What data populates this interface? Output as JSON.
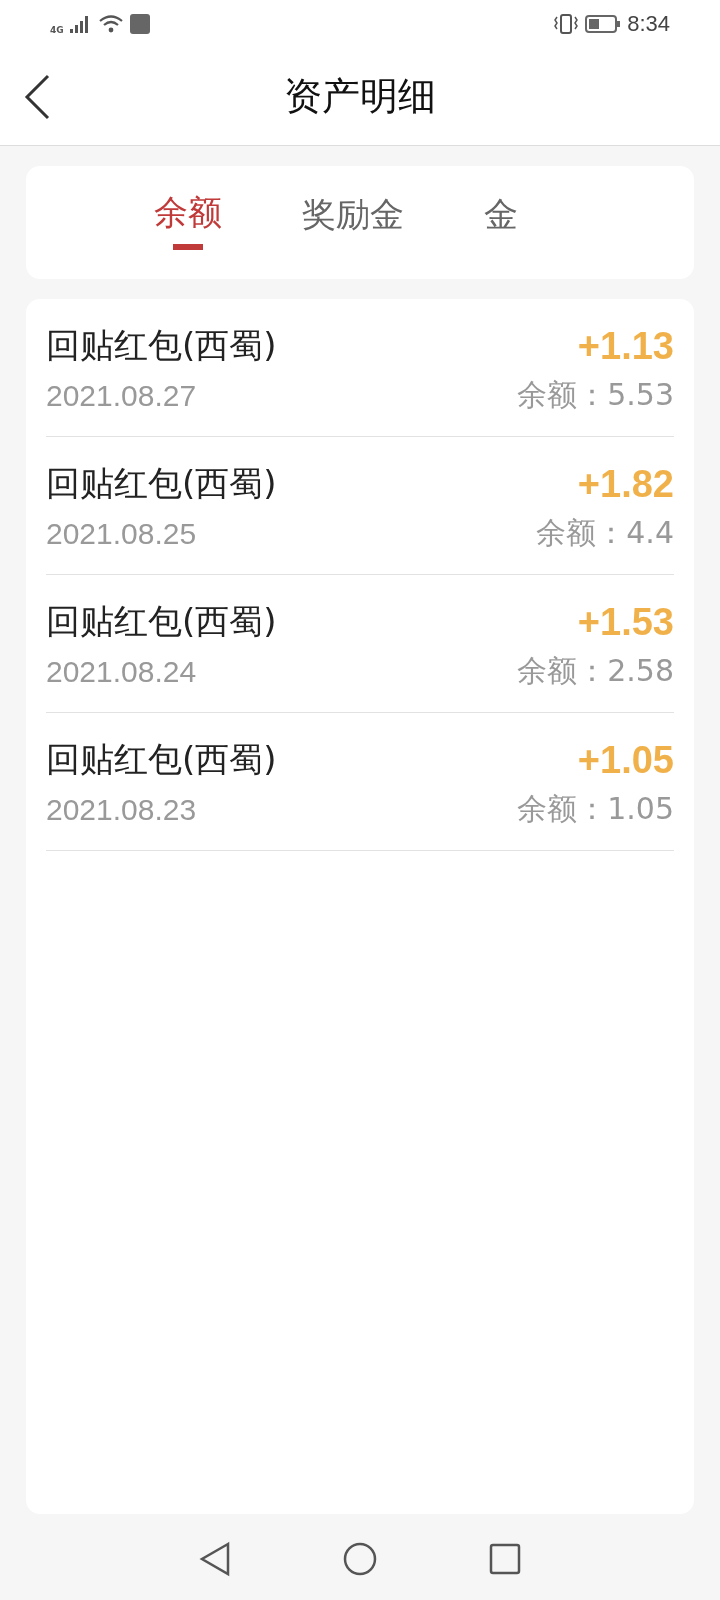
{
  "status_bar": {
    "network": "4G",
    "time": "8:34"
  },
  "header": {
    "title": "资产明细"
  },
  "tabs": [
    {
      "label": "余额",
      "selected": true
    },
    {
      "label": "奖励金",
      "selected": false
    },
    {
      "label": "金",
      "selected": false
    }
  ],
  "records": [
    {
      "title": "回贴红包(西蜀)",
      "amount": "+1.13",
      "date": "2021.08.27",
      "balance": "余额：5.53"
    },
    {
      "title": "回贴红包(西蜀)",
      "amount": "+1.82",
      "date": "2021.08.25",
      "balance": "余额：4.4"
    },
    {
      "title": "回贴红包(西蜀)",
      "amount": "+1.53",
      "date": "2021.08.24",
      "balance": "余额：2.58"
    },
    {
      "title": "回贴红包(西蜀)",
      "amount": "+1.05",
      "date": "2021.08.23",
      "balance": "余额：1.05"
    }
  ]
}
